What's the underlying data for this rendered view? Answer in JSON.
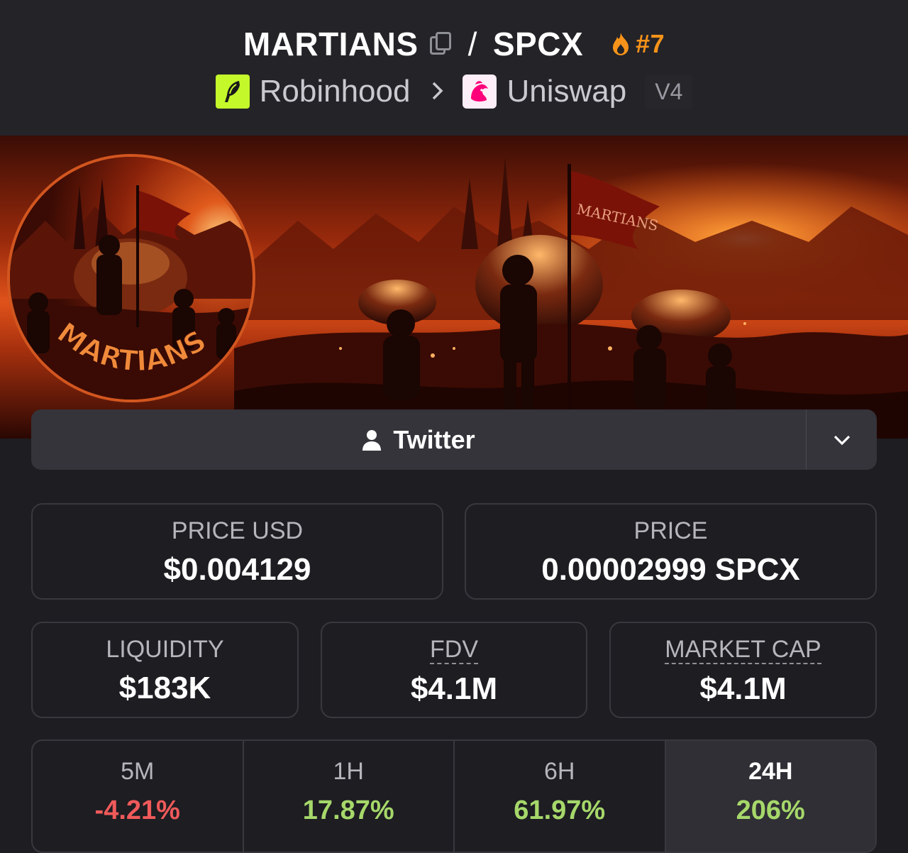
{
  "header": {
    "token_symbol": "MARTIANS",
    "separator": "/",
    "quote_symbol": "SPCX",
    "trending_rank": "#7",
    "chain": "Robinhood",
    "dex": "Uniswap",
    "dex_version": "V4"
  },
  "banner": {
    "avatar_text": "MARTIANS",
    "flag_text": "MARTIANS"
  },
  "social": {
    "twitter_label": "Twitter"
  },
  "stats": {
    "price_usd_label": "PRICE USD",
    "price_usd_value": "$0.004129",
    "price_label": "PRICE",
    "price_value": "0.00002999 SPCX",
    "liquidity_label": "LIQUIDITY",
    "liquidity_value": "$183K",
    "fdv_label": "FDV",
    "fdv_value": "$4.1M",
    "mcap_label": "MARKET CAP",
    "mcap_value": "$4.1M"
  },
  "changes": [
    {
      "label": "5M",
      "value": "-4.21%"
    },
    {
      "label": "1H",
      "value": "17.87%"
    },
    {
      "label": "6H",
      "value": "61.97%"
    },
    {
      "label": "24H",
      "value": "206%"
    }
  ],
  "colors": {
    "accent_rank": "#f7931a",
    "negative": "#f05a5a",
    "positive": "#a6d86a",
    "robinhood": "#c4f82a",
    "uniswap": "#ff007a"
  }
}
